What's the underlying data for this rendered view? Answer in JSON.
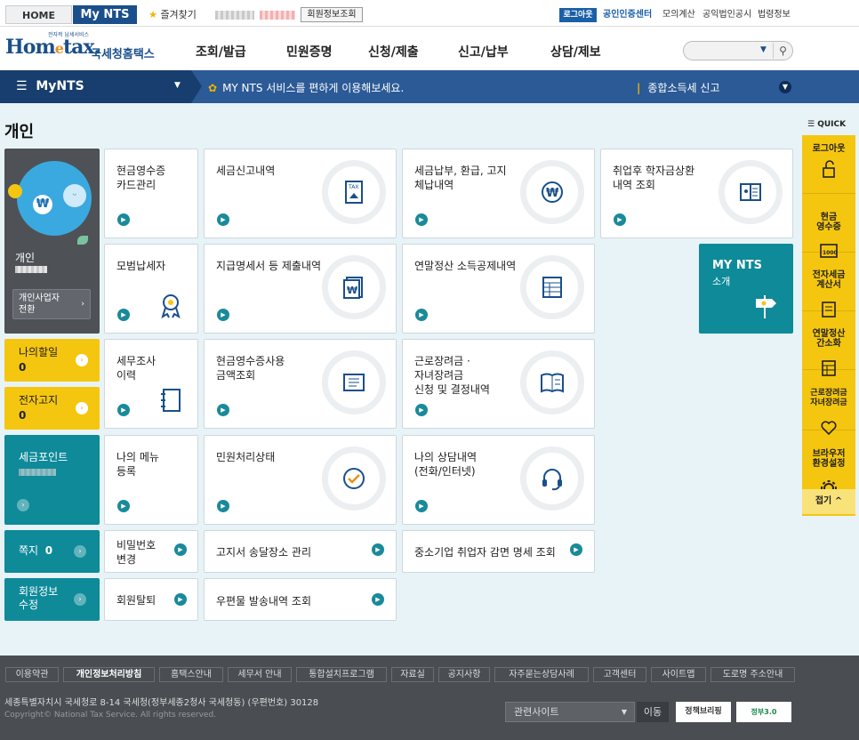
{
  "topbar": {
    "home": "HOME",
    "mynts": "My NTS",
    "favorites": "즐겨찾기",
    "member_info": "회원정보조회",
    "logout": "로그아웃",
    "cert_center": "공인인증센터",
    "mock_calc": "모의계산",
    "corp_notice": "공익법인공시",
    "law_info": "법령정보"
  },
  "header": {
    "logo_top": "전자적 납세서비스",
    "logo_home": "Hom",
    "logo_e": "e",
    "logo_tax": "tax.",
    "logo_nts": "국세청홈택스",
    "nav": [
      "조회/발급",
      "민원증명",
      "신청/제출",
      "신고/납부",
      "상담/제보"
    ]
  },
  "mybar": {
    "title": "MyNTS",
    "message": "MY NTS 서비스를 편하게 이용해보세요.",
    "notice": "종합소득세 신고"
  },
  "page": {
    "title": "개인"
  },
  "profile": {
    "type": "개인",
    "switch_button": "개인사업자\n전환"
  },
  "side": {
    "todo": "나의할일",
    "todo_count": "0",
    "ebill": "전자고지",
    "ebill_count": "0",
    "tax_point": "세금포인트",
    "memo": "쪽지",
    "memo_count": "0",
    "member_edit": "회원정보\n수정"
  },
  "cards": {
    "cash_receipt_card": "현금영수증\n카드관리",
    "tax_report": "세금신고내역",
    "tax_payment": "세금납부, 환급, 고지\n체납내역",
    "student_loan": "취업후 학자금상환\n내역 조회",
    "model_taxpayer": "모범납세자",
    "payment_statement": "지급명세서 등 제출내역",
    "year_end": "연말정산 소득공제내역",
    "mynts_intro_title": "MY NTS",
    "mynts_intro_sub": "소개",
    "tax_audit": "세무조사\n이력",
    "cash_usage": "현금영수증사용\n금액조회",
    "earned_income": "근로장려금 ·\n자녀장려금\n신청 및 결정내역",
    "my_menu": "나의 메뉴\n등록",
    "petition_status": "민원처리상태",
    "my_consult": "나의 상담내역\n(전화/인터넷)",
    "password_change": "비밀번호\n변경",
    "notice_address": "고지서 송달장소 관리",
    "sme_reduction": "중소기업 취업자 감면 명세 조회",
    "withdraw": "회원탈퇴",
    "mail_history": "우편물 발송내역 조회"
  },
  "quick": {
    "title": "QUICK",
    "items": [
      "로그아웃",
      "현금\n영수증",
      "전자세금\n계산서",
      "연말정산\n간소화",
      "근로장려금\n자녀장려금",
      "브라우저\n환경설정"
    ],
    "fold": "접기"
  },
  "footer": {
    "links": [
      "이용약관",
      "개인정보처리방침",
      "홈택스안내",
      "세무서 안내",
      "통합설치프로그램",
      "자료실",
      "공지사항",
      "자주묻는상담사례",
      "고객센터",
      "사이트맵",
      "도로명 주소안내"
    ],
    "address": "세종특별자치시 국세청로 8-14 국세청(정부세종2청사 국세청동) (우편번호) 30128",
    "copyright": "Copyright© National Tax Service. All rights reserved.",
    "related": "관련사이트",
    "move": "이동",
    "policy": "정책브리핑",
    "badge": "정부3.0"
  },
  "colors": {
    "navy": "#173e6e",
    "blue": "#2b5a96",
    "teal": "#0e8a99",
    "yellow": "#f5c60f",
    "bg": "#e8f3f7"
  }
}
